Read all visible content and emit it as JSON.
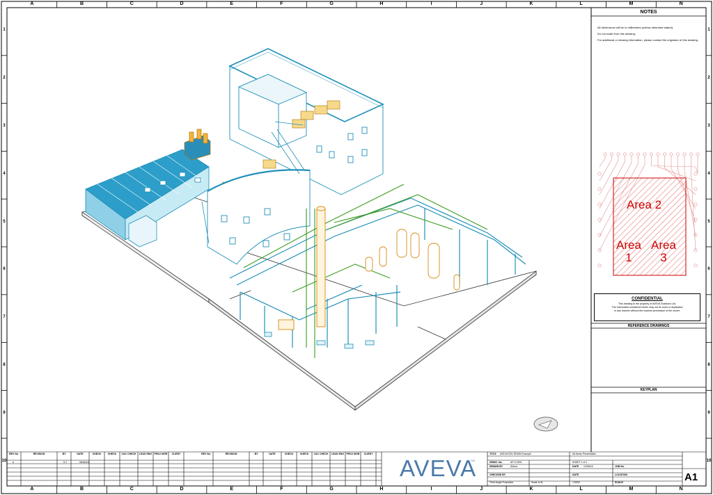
{
  "border": {
    "columns": [
      "A",
      "B",
      "C",
      "D",
      "E",
      "F",
      "G",
      "H",
      "I",
      "J",
      "K",
      "L",
      "M",
      "N"
    ],
    "rows": [
      "1",
      "2",
      "3",
      "4",
      "5",
      "6",
      "7",
      "8",
      "9",
      "10"
    ]
  },
  "notes": {
    "heading": "NOTES",
    "lines": [
      "All dimensions will be in millimetres (unless otherwise stated).",
      "Do not scale from this drawing.",
      "For additional or missing information, please contact the originator of this drawing."
    ]
  },
  "keyplan": {
    "area2": "Area 2",
    "area1_line1": "Area",
    "area1_line2": "1",
    "area3_line1": "Area",
    "area3_line2": "3"
  },
  "confidential": {
    "heading": "CONFIDENTIAL",
    "text1": "This drawing is the property of AVEVA Solutions Ltd.",
    "text2": "The information contained herein may not be used or duplicated",
    "text3": "in any manner without the express permission of the owner."
  },
  "reference_drawings": "REFERENCE DRAWINGS",
  "keyplan_heading": "KEYPLAN",
  "revision_table": {
    "headers_left": [
      "REV No.",
      "REVISION",
      "BY",
      "DATE",
      "CHECK",
      "CHECK",
      "C&C CHECK",
      "LEAD ENG",
      "PROJ MGR",
      "CLIENT"
    ],
    "headers_right": [
      "REV No.",
      "REVISION",
      "BY",
      "DATE",
      "CHECK",
      "CHECK",
      "C&C CHECK",
      "LEAD ENG",
      "PROJ MGR",
      "CLIENT"
    ],
    "row1": [
      "A",
      "",
      "S.T",
      "06/06/16"
    ]
  },
  "titleblock": {
    "logo": "AVEVA",
    "tm": "TM",
    "title_label": "TITLE",
    "title_value": "AVEVA E3D DRAW Example",
    "title_value2": "All Areas Presentation",
    "drawing_no_label": "DRWG. No.",
    "drawing_no": "AP-0-0001",
    "sheet": "SHEET 1 of 1",
    "drawn_by_label": "DRAWN BY",
    "drawn_by": "AVeva",
    "date_label": "DATE",
    "date_value": "12/06/16",
    "job_label": "JOB No.",
    "checked_by_label": "CHECKED BY",
    "checked_date_label": "DATE",
    "location_label": "LOCATION",
    "projection": "Third Angle Projection",
    "scale_label": "Scale to fit",
    "scale_value": "1:5000",
    "scale_word": "SCALE",
    "sheet_size": "A1"
  }
}
